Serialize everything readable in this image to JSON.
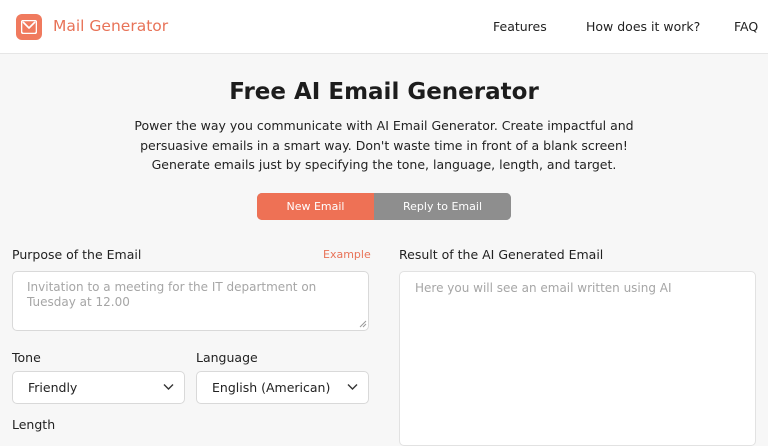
{
  "header": {
    "brand": "Mail Generator",
    "nav": [
      "Features",
      "How does it work?",
      "FAQ"
    ]
  },
  "hero": {
    "title": "Free AI Email Generator",
    "lead": [
      "Power the way you communicate with AI Email Generator. Create impactful and",
      "persuasive emails in a smart way. Don't waste time in front of a blank screen!",
      "Generate emails just by specifying the tone, language, length, and target."
    ]
  },
  "mode_toggle": {
    "options": [
      "New Email",
      "Reply to Email"
    ],
    "selected": "New Email"
  },
  "form": {
    "purpose_label": "Purpose of the Email",
    "example_link": "Example",
    "purpose_placeholder": "Invitation to a meeting for the IT department on Tuesday at 12.00",
    "purpose_value": "",
    "tone_label": "Tone",
    "tone_value": "Friendly",
    "language_label": "Language",
    "language_value": "English (American)",
    "length_label": "Length"
  },
  "result": {
    "label": "Result of the AI Generated Email",
    "placeholder": "Here you will see an email written using AI"
  },
  "colors": {
    "accent": "#ee7155",
    "toggle_inactive": "#8e8e8e",
    "background": "#f7f7f7"
  },
  "icons": [
    "mail-logo-icon",
    "chevron-down-icon",
    "resize-grip-icon"
  ]
}
